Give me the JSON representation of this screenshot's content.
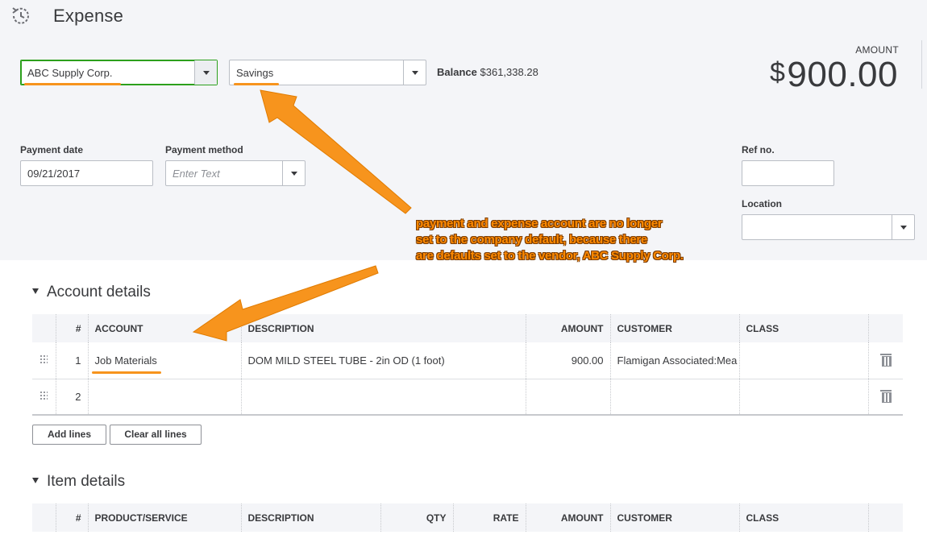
{
  "header": {
    "title": "Expense",
    "payee_value": "ABC Supply Corp.",
    "payment_account_value": "Savings",
    "balance_label": "Balance",
    "balance_value": "$361,338.28",
    "amount_label": "AMOUNT",
    "amount_currency": "$",
    "amount_value": "900.00"
  },
  "fields": {
    "payment_date_label": "Payment date",
    "payment_date_value": "09/21/2017",
    "payment_method_label": "Payment method",
    "payment_method_placeholder": "Enter Text",
    "ref_no_label": "Ref no.",
    "location_label": "Location"
  },
  "account_details": {
    "title": "Account details",
    "columns": [
      "#",
      "ACCOUNT",
      "DESCRIPTION",
      "AMOUNT",
      "CUSTOMER",
      "CLASS"
    ],
    "rows": [
      {
        "num": "1",
        "account": "Job Materials",
        "description": "DOM MILD STEEL TUBE - 2in OD (1 foot)",
        "amount": "900.00",
        "customer": "Flamigan Associated:Mea",
        "class": ""
      },
      {
        "num": "2",
        "account": "",
        "description": "",
        "amount": "",
        "customer": "",
        "class": ""
      }
    ],
    "add_lines_label": "Add lines",
    "clear_lines_label": "Clear all lines"
  },
  "item_details": {
    "title": "Item details",
    "columns": [
      "#",
      "PRODUCT/SERVICE",
      "DESCRIPTION",
      "QTY",
      "RATE",
      "AMOUNT",
      "CUSTOMER",
      "CLASS"
    ]
  },
  "annotation": {
    "lines": [
      "payment and expense account are no longer",
      "set to the company default, because there",
      "are defaults set to the vendor, ABC Supply Corp."
    ],
    "highlight_color": "#f7941d"
  },
  "icons": {
    "history": "history-clock-icon",
    "dropdown": "chevron-down-icon",
    "drag": "drag-handle-icon",
    "delete": "trash-icon",
    "collapse": "triangle-down-icon"
  }
}
